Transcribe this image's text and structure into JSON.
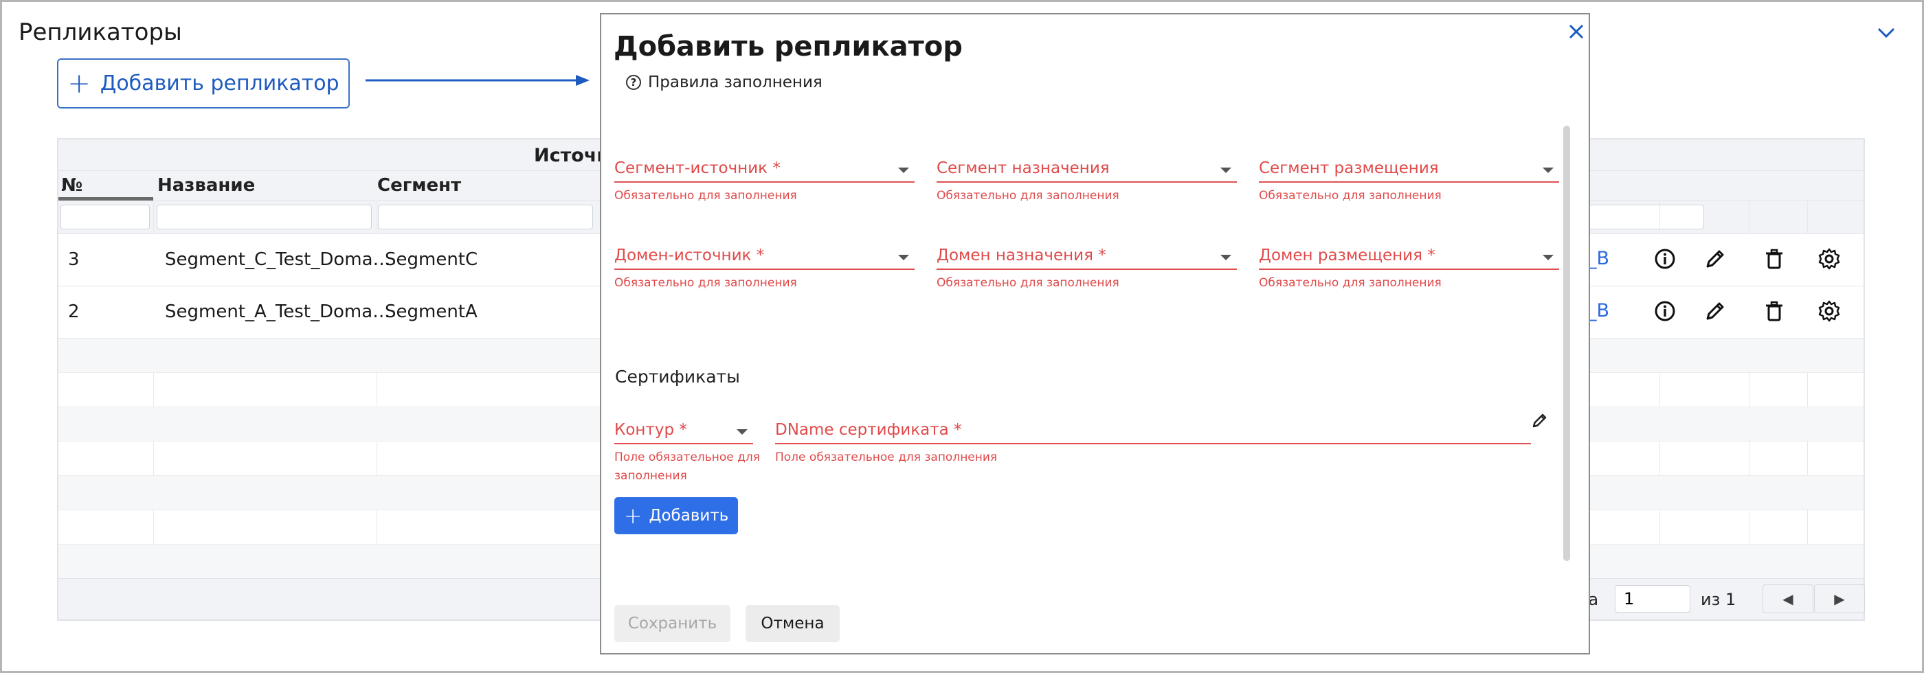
{
  "page": {
    "title": "Репликаторы",
    "add_button_label": "Добавить репликатор"
  },
  "table": {
    "group_header": "Источник",
    "columns": [
      "№",
      "Название",
      "Сегмент"
    ],
    "rows": [
      {
        "num": "3",
        "name": "Segment_C_Test_Doma…",
        "segment": "SegmentC",
        "link": "_B"
      },
      {
        "num": "2",
        "name": "Segment_A_Test_Doma…",
        "segment": "SegmentA",
        "link": "_B"
      }
    ],
    "pager": {
      "page_label": "ца",
      "page_value": "1",
      "of_label": "из 1",
      "prev_icon": "◀",
      "next_icon": "▶"
    }
  },
  "modal": {
    "title": "Добавить репликатор",
    "rules_label": "Правила заполнения",
    "fields_row1": [
      {
        "label": "Сегмент-источник",
        "required": "*",
        "error": "Обязательно для заполнения"
      },
      {
        "label": "Сегмент назначения",
        "required": "",
        "error": "Обязательно для заполнения"
      },
      {
        "label": "Сегмент размещения",
        "required": "",
        "error": "Обязательно для заполнения"
      }
    ],
    "fields_row2": [
      {
        "label": "Домен-источник",
        "required": "*",
        "error": "Обязательно для заполнения"
      },
      {
        "label": "Домен назначения",
        "required": "*",
        "error": "Обязательно для заполнения"
      },
      {
        "label": "Домен размещения",
        "required": "*",
        "error": "Обязательно для заполнения"
      }
    ],
    "certificates": {
      "section_title": "Сертификаты",
      "contour_label": "Контур",
      "contour_required": "*",
      "contour_error_line1": "Поле обязательное для",
      "contour_error_line2": "заполнения",
      "dname_label": "DName сертификата",
      "dname_required": "*",
      "dname_error": "Поле обязательное для заполнения",
      "add_label": "Добавить"
    },
    "save_label": "Сохранить",
    "cancel_label": "Отмена"
  },
  "colors": {
    "accent": "#2e6ee6",
    "error": "#e04a4a",
    "link": "#2a6ae0"
  },
  "icons": [
    "chevron-down-icon",
    "arrow-right-icon",
    "close-icon",
    "question-icon",
    "info-icon",
    "pencil-icon",
    "trash-icon",
    "gear-icon",
    "caret-down-icon",
    "plus-icon"
  ]
}
